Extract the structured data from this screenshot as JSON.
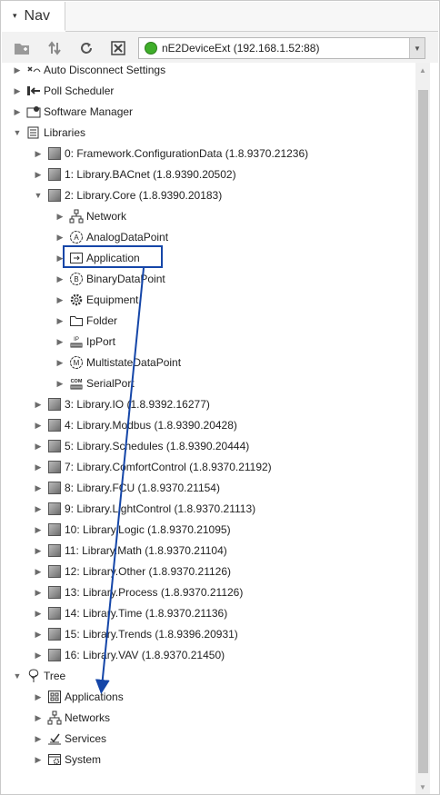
{
  "header": {
    "title": "Nav",
    "caret": "▾"
  },
  "toolbar": {
    "station": "nE2DeviceExt (192.168.1.52:88)",
    "buttons": [
      "new-folder-icon",
      "sort-icon",
      "refresh-icon",
      "close-icon"
    ]
  },
  "tree": {
    "top_items": [
      {
        "label": "Auto Disconnect Settings",
        "icon": "disconnect-icon"
      },
      {
        "label": "Poll Scheduler",
        "icon": "poll-scheduler-icon"
      },
      {
        "label": "Software Manager",
        "icon": "software-manager-icon"
      }
    ],
    "libraries_label": "Libraries",
    "libraries": [
      "0: Framework.ConfigurationData (1.8.9370.21236)",
      "1: Library.BACnet (1.8.9390.20502)",
      "2: Library.Core (1.8.9390.20183)"
    ],
    "core_children": [
      {
        "label": "Network",
        "icon": "network-icon"
      },
      {
        "label": "AnalogDataPoint",
        "icon": "analog-point-icon"
      },
      {
        "label": "Application",
        "icon": "application-icon"
      },
      {
        "label": "BinaryDataPoint",
        "icon": "binary-point-icon"
      },
      {
        "label": "Equipment",
        "icon": "gear-icon"
      },
      {
        "label": "Folder",
        "icon": "folder-icon"
      },
      {
        "label": "IpPort",
        "icon": "ip-port-icon"
      },
      {
        "label": "MultistateDataPoint",
        "icon": "multistate-point-icon"
      },
      {
        "label": "SerialPort",
        "icon": "serial-port-icon"
      }
    ],
    "more_libraries": [
      "3: Library.IO (1.8.9392.16277)",
      "4: Library.Modbus (1.8.9390.20428)",
      "5: Library.Schedules (1.8.9390.20444)",
      "7: Library.ComfortControl (1.8.9370.21192)",
      "8: Library.FCU (1.8.9370.21154)",
      "9: Library.LightControl (1.8.9370.21113)",
      "10: Library.Logic (1.8.9370.21095)",
      "11: Library.Math (1.8.9370.21104)",
      "12: Library.Other (1.8.9370.21126)",
      "13: Library.Process (1.8.9370.21126)",
      "14: Library.Time (1.8.9370.21136)",
      "15: Library.Trends (1.8.9396.20931)",
      "16: Library.VAV (1.8.9370.21450)"
    ],
    "tree_label": "Tree",
    "tree_children": [
      {
        "label": "Applications",
        "icon": "applications-icon"
      },
      {
        "label": "Networks",
        "icon": "networks-icon"
      },
      {
        "label": "Services",
        "icon": "services-icon"
      },
      {
        "label": "System",
        "icon": "system-icon"
      }
    ]
  },
  "colors": {
    "highlight": "#1546a8",
    "status_ok": "#3fae2a"
  }
}
